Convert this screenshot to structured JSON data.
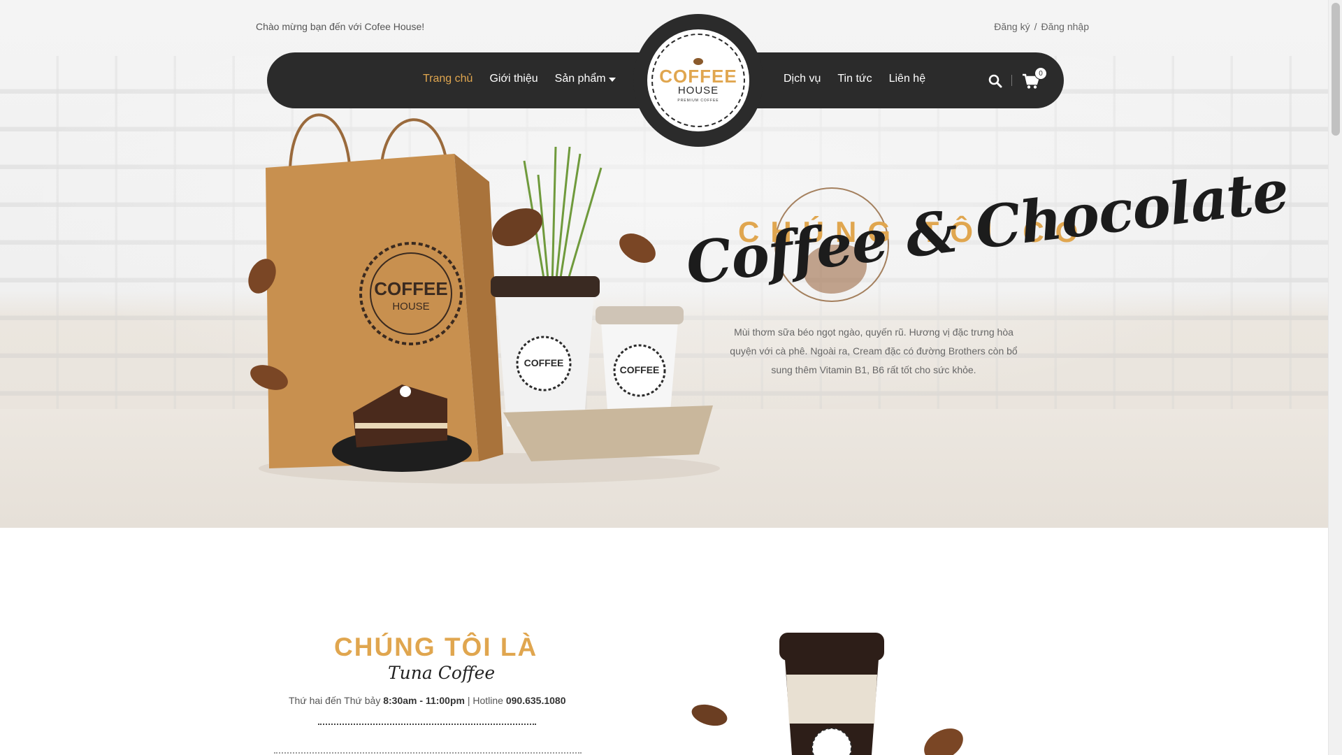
{
  "topbar": {
    "welcome": "Chào mừng bạn đến với Cofee House!",
    "register": "Đăng ký",
    "separator": "/",
    "login": "Đăng nhập"
  },
  "nav": {
    "left": [
      {
        "label": "Trang chủ",
        "active": true
      },
      {
        "label": "Giới thiệu",
        "active": false
      },
      {
        "label": "Sản phẩm",
        "active": false,
        "has_dropdown": true
      }
    ],
    "right": [
      {
        "label": "Dịch vụ"
      },
      {
        "label": "Tin tức"
      },
      {
        "label": "Liên hệ"
      }
    ],
    "cart_count": "0",
    "search_icon": "search-icon",
    "cart_icon": "cart-icon"
  },
  "logo": {
    "line1": "COFFEE",
    "line2": "HOUSE",
    "line3": "PREMIUM COFFEE"
  },
  "bag_logo": {
    "line1": "COFFEE",
    "line2": "HOUSE"
  },
  "hero": {
    "eyebrow": "CHÚNG TÔI CÓ",
    "script": "Coffee & Chocolate",
    "description": "Mùi thơm sữa béo ngọt ngào, quyến rũ. Hương vị đặc trưng hòa quyện với cà phê. Ngoài ra, Cream đặc có đường Brothers còn bổ sung thêm Vitamin B1, B6 rất tốt cho sức khỏe."
  },
  "about": {
    "title": "CHÚNG TÔI LÀ",
    "script": "Tuna Coffee",
    "hours_prefix": "Thứ hai đến Thứ bảy ",
    "hours": "8:30am - 11:00pm",
    "hotline_prefix": " | Hotline ",
    "hotline": "090.635.1080"
  },
  "colors": {
    "accent": "#e0a64f",
    "nav_bg": "#2b2b2b",
    "text": "#333333"
  }
}
